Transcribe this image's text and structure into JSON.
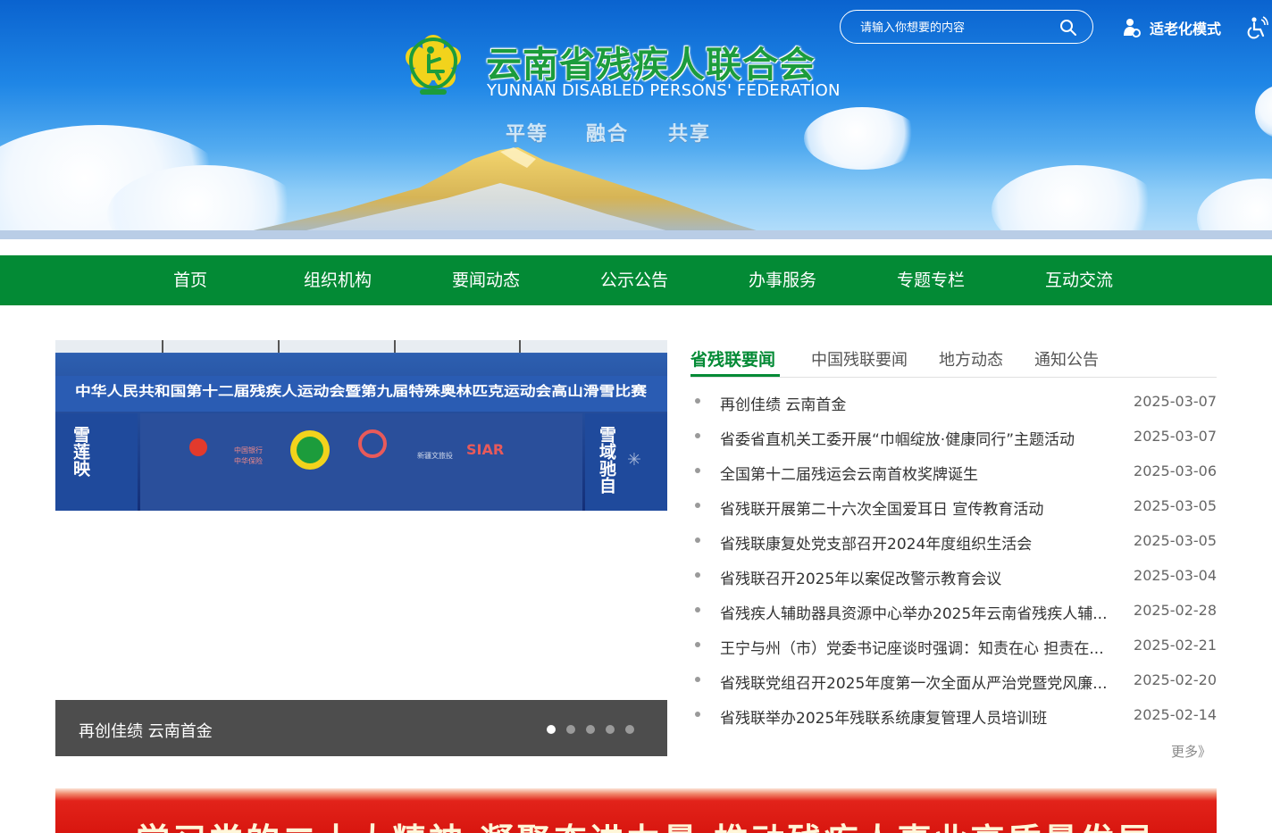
{
  "header": {
    "title_cn": "云南省残疾人联合会",
    "title_en": "YUNNAN DISABLED PERSONS' FEDERATION",
    "slogans": [
      "平等",
      "融合",
      "共享"
    ],
    "search_placeholder": "请输入你想要的内容",
    "elder_mode_label": "适老化模式",
    "icons": {
      "search": "search-icon",
      "elder": "elder-mode-icon",
      "accessibility": "wheelchair-icon"
    }
  },
  "nav": {
    "items": [
      "首页",
      "组织机构",
      "要闻动态",
      "公示公告",
      "办事服务",
      "专题专栏",
      "互动交流"
    ]
  },
  "slider": {
    "image": {
      "header_text": "中华人民共和国第十二届残疾人运动会暨第九届特殊奥林匹克运动会高山滑雪比赛",
      "left_banner": "雪莲映",
      "right_banner": "雪域驰自",
      "sponsor_marks": [
        "中国银行",
        "中华保险",
        "新疆文旅投",
        "SIAR"
      ]
    },
    "caption": "再创佳绩 云南首金",
    "dot_count": 5,
    "active_dot": 0
  },
  "news": {
    "tabs": [
      "省残联要闻",
      "中国残联要闻",
      "地方动态",
      "通知公告"
    ],
    "active_tab": 0,
    "items": [
      {
        "title": "再创佳绩 云南首金",
        "date": "2025-03-07"
      },
      {
        "title": "省委省直机关工委开展“巾帼绽放·健康同行”主题活动",
        "date": "2025-03-07"
      },
      {
        "title": "全国第十二届残运会云南首枚奖牌诞生",
        "date": "2025-03-06"
      },
      {
        "title": "省残联开展第二十六次全国爱耳日 宣传教育活动",
        "date": "2025-03-05"
      },
      {
        "title": "省残联康复处党支部召开2024年度组织生活会",
        "date": "2025-03-05"
      },
      {
        "title": "省残联召开2025年以案促改警示教育会议",
        "date": "2025-03-04"
      },
      {
        "title": "省残疾人辅助器具资源中心举办2025年云南省残疾人辅...",
        "date": "2025-02-28"
      },
      {
        "title": "王宁与州（市）党委书记座谈时强调：知责在心 担责在...",
        "date": "2025-02-21"
      },
      {
        "title": "省残联党组召开2025年度第一次全面从严治党暨党风廉...",
        "date": "2025-02-20"
      },
      {
        "title": "省残联举办2025年残联系统康复管理人员培训班",
        "date": "2025-02-14"
      }
    ],
    "more_label": "更多》"
  },
  "banner": {
    "text": "学习党的二十大精神 凝聚奋进力量 推动残疾人事业高质量发展"
  },
  "colors": {
    "brand_green": "#038a35",
    "sky_blue": "#1f86e6",
    "caption_bg": "#4d4d4d",
    "banner_red": "#d8160f"
  }
}
